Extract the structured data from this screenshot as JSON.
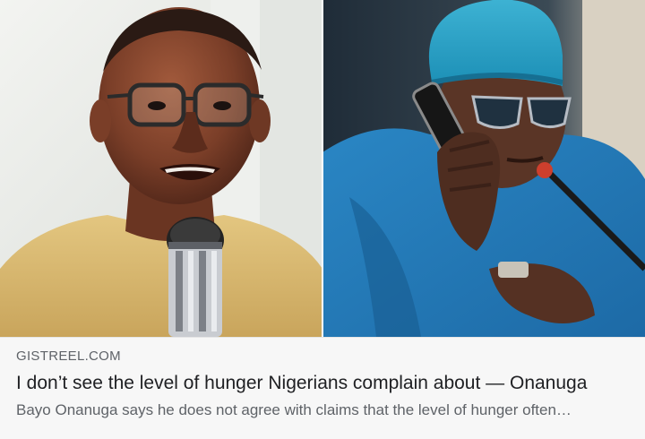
{
  "article": {
    "source": "GISTREEL.COM",
    "headline": "I don’t see the level of hunger Nigerians complain about — Onanuga",
    "snippet": "Bayo Onanuga says he does not agree with claims that the level of hunger often…"
  },
  "images": {
    "left_photo": "man-speaking-into-microphone",
    "right_photo": "man-in-blue-cap-on-phone"
  },
  "colors": {
    "meta_background": "#f7f7f7",
    "headline_text": "#202124",
    "secondary_text": "#5f6368"
  }
}
